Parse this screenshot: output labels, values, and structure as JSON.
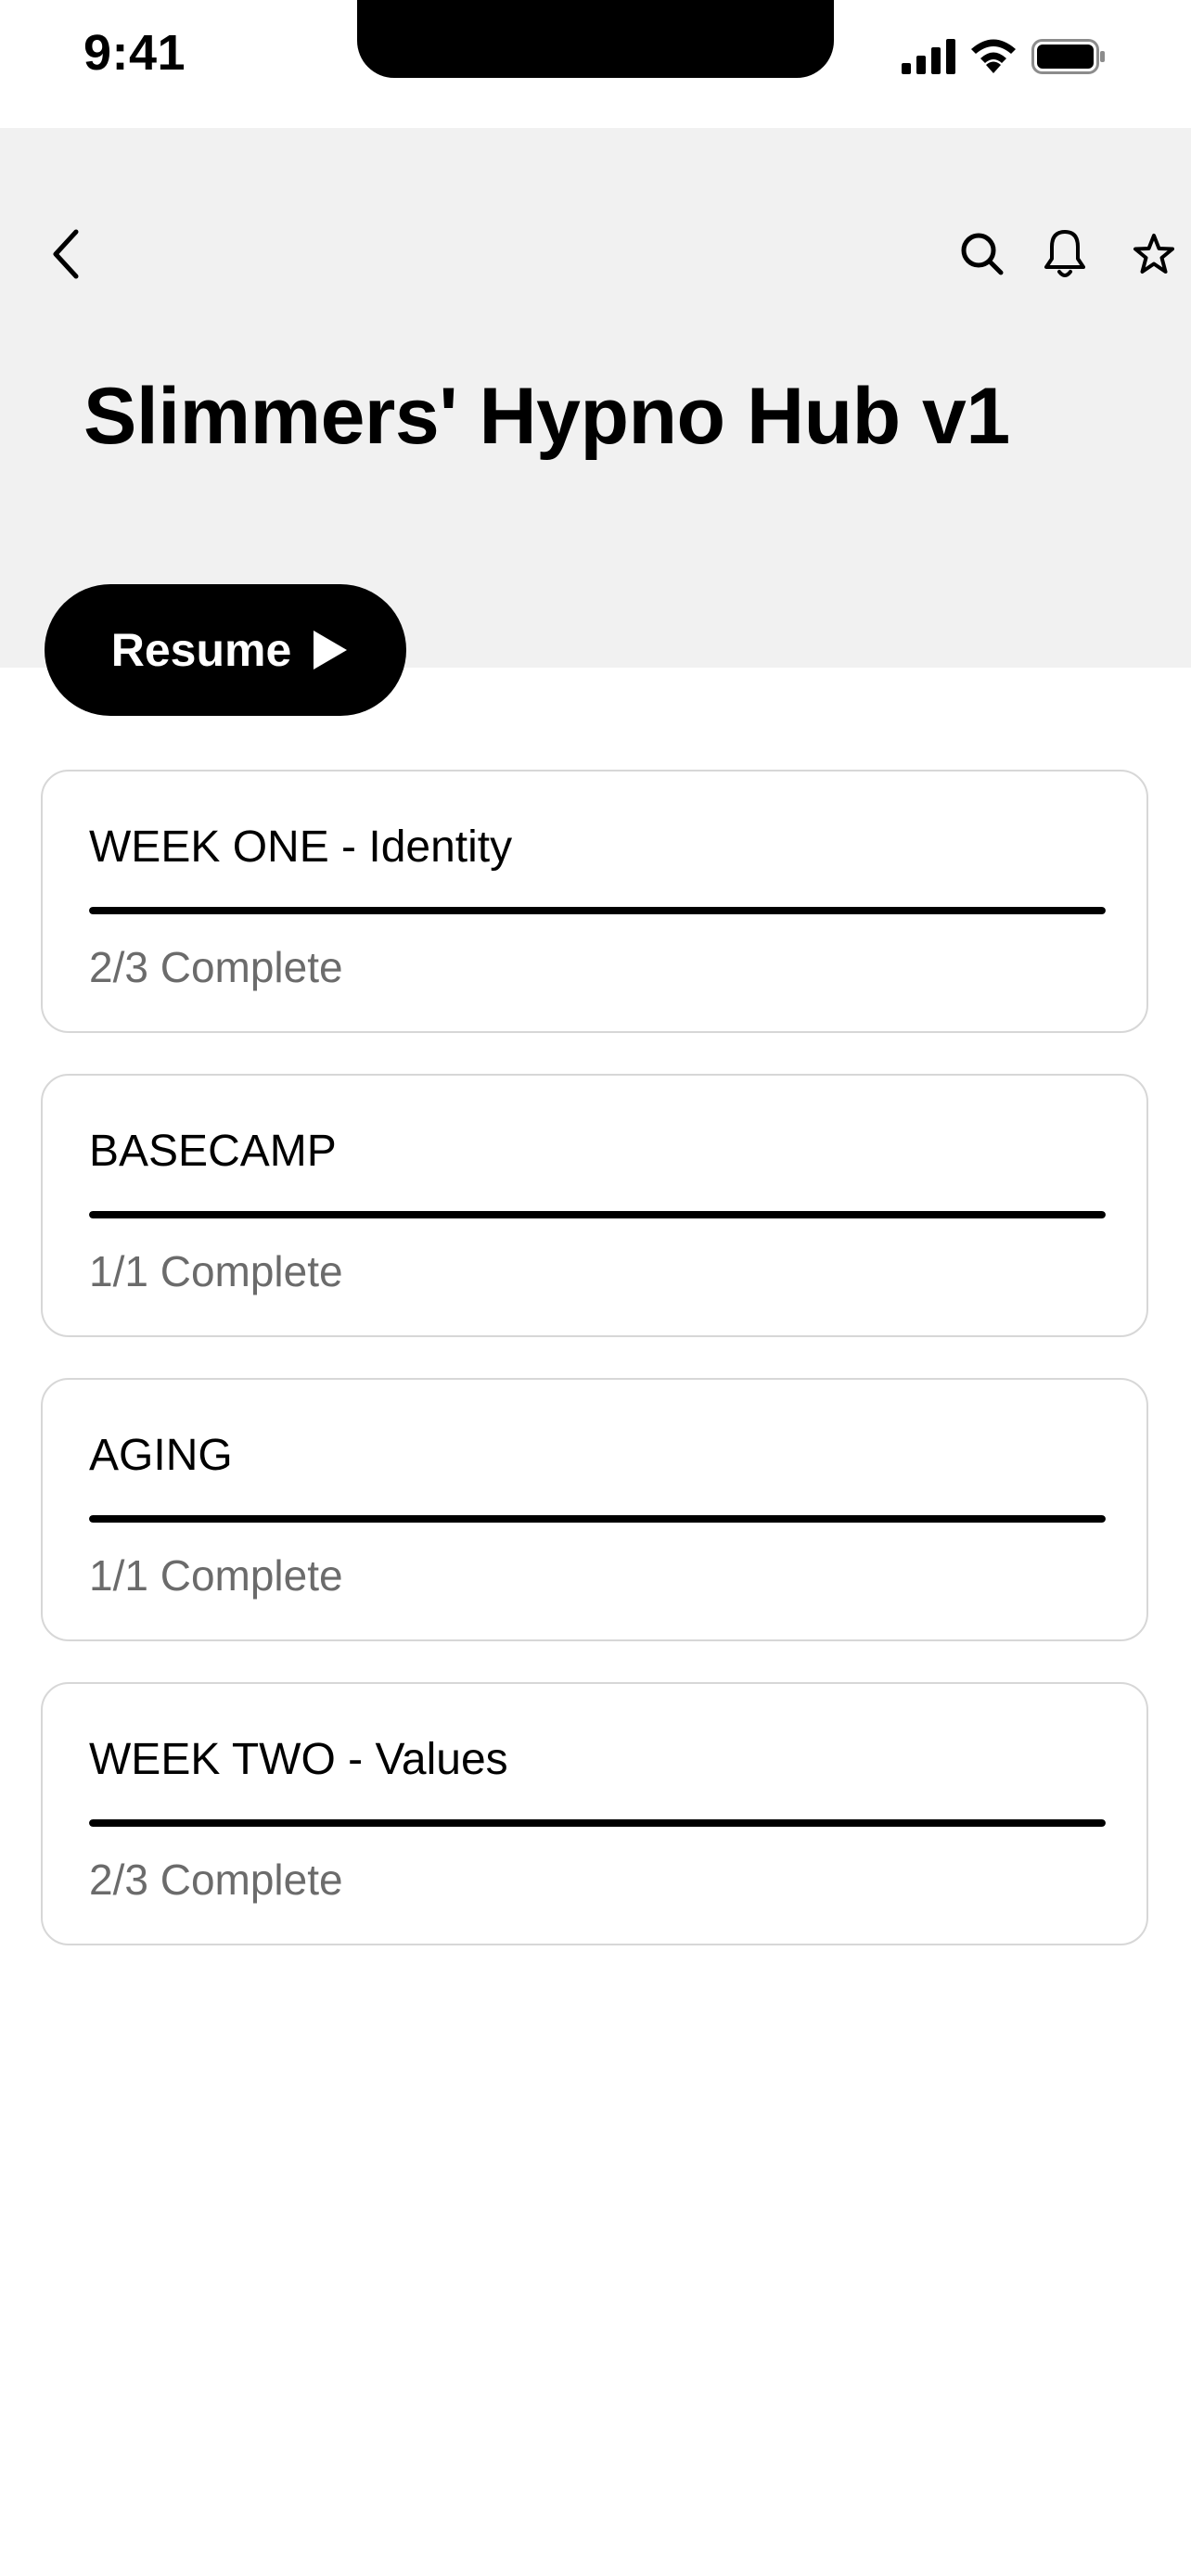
{
  "status_bar": {
    "time": "9:41"
  },
  "header": {
    "title": "Slimmers' Hypno Hub v1",
    "back_icon": "chevron-left-icon",
    "search_icon": "search-icon",
    "bell_icon": "bell-icon",
    "star_icon": "star-icon"
  },
  "resume": {
    "label": "Resume",
    "icon": "play-icon"
  },
  "colors": {
    "header_bg": "#f1f1f1",
    "accent": "#000000",
    "muted_text": "#6b6b6b",
    "card_border": "#d7d7d7"
  },
  "modules": [
    {
      "title": "WEEK ONE - Identity",
      "status": "2/3 Complete",
      "progress": 1.0
    },
    {
      "title": "BASECAMP",
      "status": "1/1 Complete",
      "progress": 1.0
    },
    {
      "title": "AGING",
      "status": "1/1 Complete",
      "progress": 1.0
    },
    {
      "title": "WEEK TWO - Values",
      "status": "2/3 Complete",
      "progress": 1.0
    }
  ]
}
